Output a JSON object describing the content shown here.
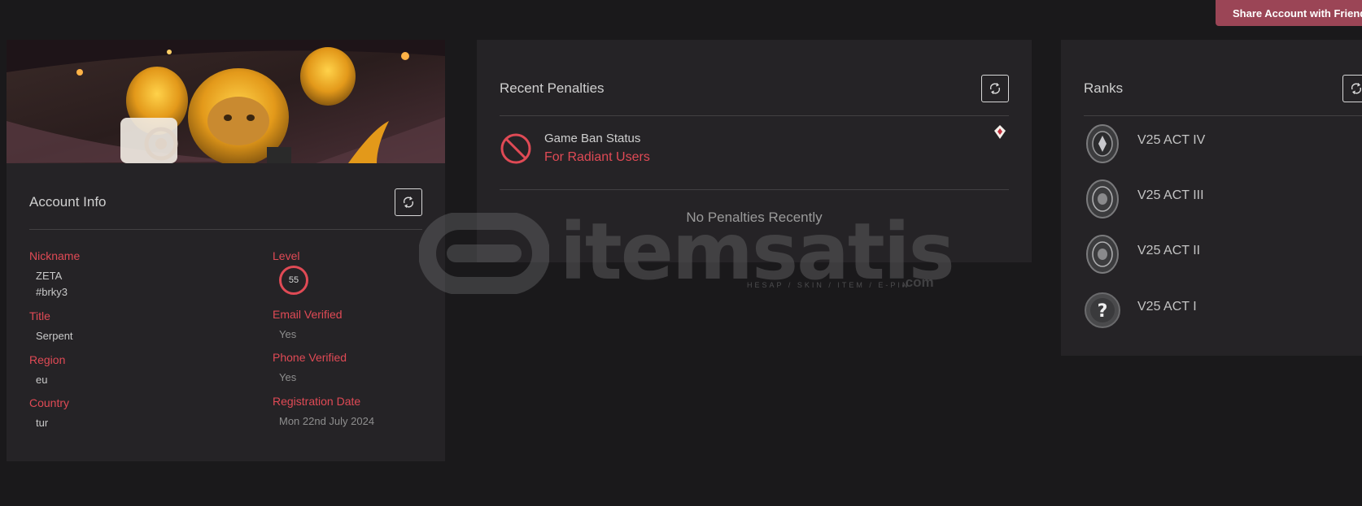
{
  "share_button_label": "Share Account with Friends",
  "account": {
    "title": "Account Info",
    "nickname_label": "Nickname",
    "nickname": "ZETA",
    "tag": "#brky3",
    "title_label": "Title",
    "title_value": "Serpent",
    "region_label": "Region",
    "region": "eu",
    "country_label": "Country",
    "country": "tur",
    "level_label": "Level",
    "level": "55",
    "email_label": "Email Verified",
    "email_value": "Yes",
    "phone_label": "Phone Verified",
    "phone_value": "Yes",
    "registration_label": "Registration Date",
    "registration_value": "Mon 22nd July 2024"
  },
  "penalties": {
    "title": "Recent Penalties",
    "ban_title": "Game Ban Status",
    "ban_subtitle": "For Radiant Users",
    "empty_text": "No Penalties Recently"
  },
  "ranks": {
    "title": "Ranks",
    "items": [
      {
        "label": "V25 ACT IV"
      },
      {
        "label": "V25 ACT III"
      },
      {
        "label": "V25 ACT II"
      },
      {
        "label": "V25 ACT I"
      }
    ]
  },
  "watermark": {
    "brand": "itemsatis",
    "sub": "HESAP / SKIN / ITEM / E-PIN",
    "suffix": ".com"
  },
  "colors": {
    "accent_red": "#e04a55",
    "share_button": "#9b4556",
    "card_bg": "#252326",
    "page_bg": "#1a191b"
  }
}
